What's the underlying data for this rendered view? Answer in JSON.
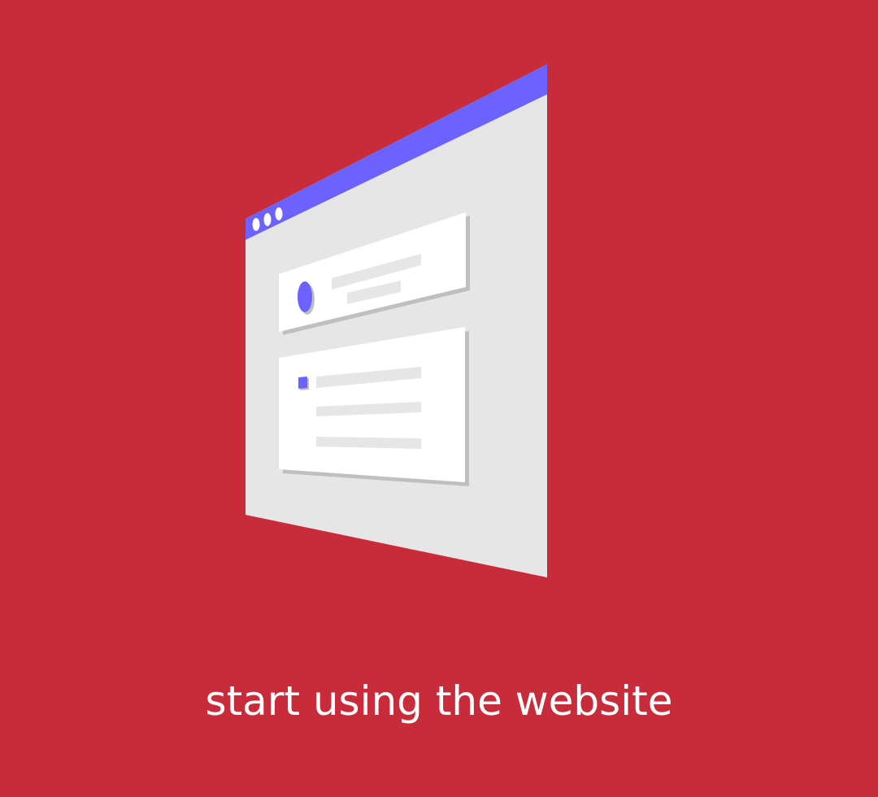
{
  "colors": {
    "background": "#C82B3A",
    "window_frame": "#E6E6E6",
    "title_bar": "#6C63FF",
    "card": "#FFFFFF",
    "card_shadow": "#BFBFBF",
    "placeholder_line": "#E6E6E6",
    "accent": "#6C63FF",
    "caption_text": "#FFFFFF"
  },
  "caption": {
    "text": "start using the website"
  },
  "illustration": {
    "icons": [
      "browser-window-illustration",
      "avatar-placeholder-icon",
      "checkbox-placeholder-icon"
    ]
  }
}
